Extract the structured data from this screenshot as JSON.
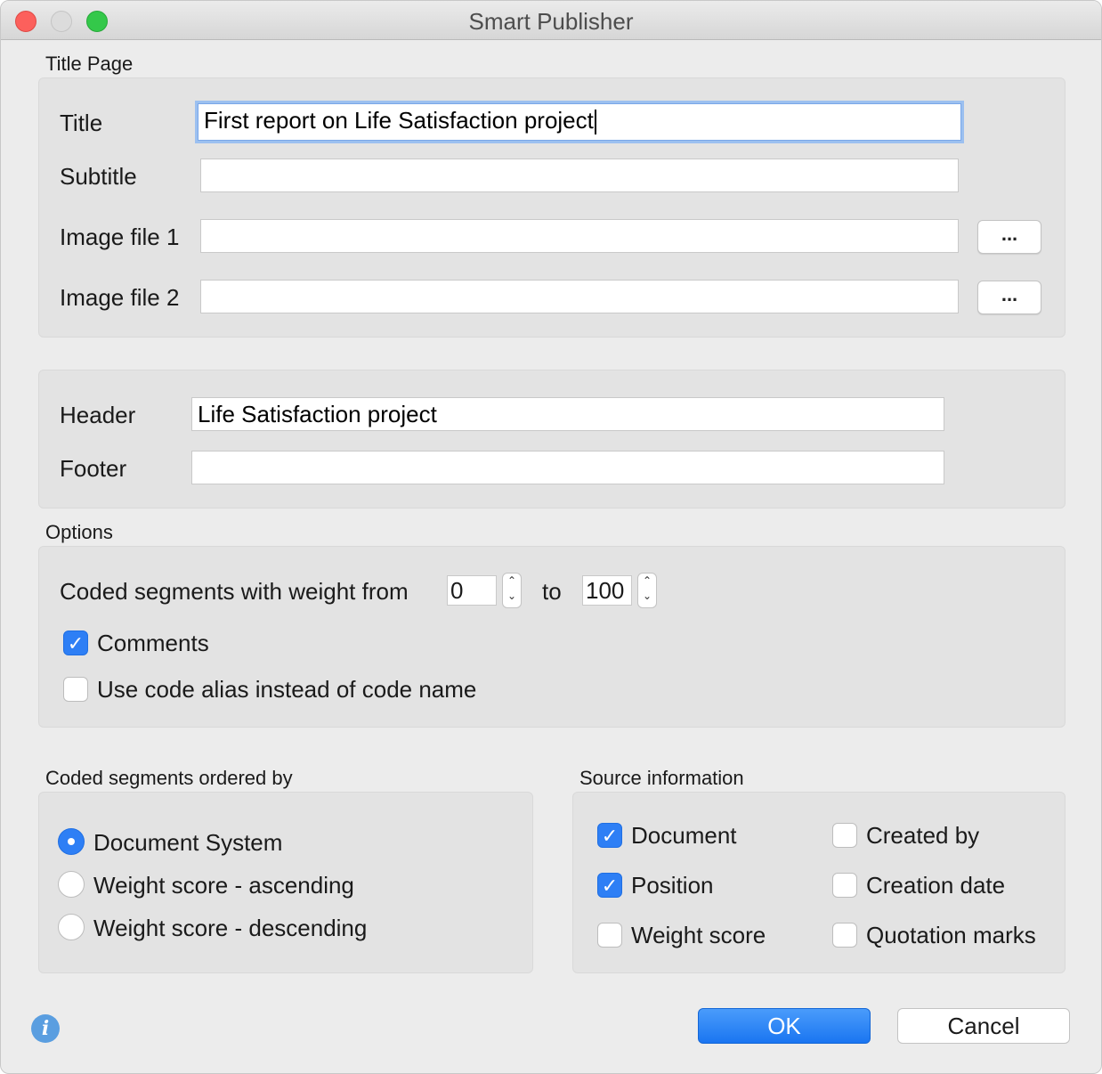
{
  "window": {
    "title": "Smart Publisher"
  },
  "title_page": {
    "section_label": "Title Page",
    "title_label": "Title",
    "title_value": "First report on Life Satisfaction project",
    "subtitle_label": "Subtitle",
    "subtitle_value": "",
    "image1_label": "Image file 1",
    "image1_value": "",
    "image2_label": "Image file 2",
    "image2_value": "",
    "browse_label": "..."
  },
  "header_footer": {
    "header_label": "Header",
    "header_value": "Life Satisfaction project",
    "footer_label": "Footer",
    "footer_value": ""
  },
  "options": {
    "section_label": "Options",
    "weight_label": "Coded segments with weight from",
    "weight_from": "0",
    "to_label": "to",
    "weight_to": "100",
    "comments_label": "Comments",
    "comments_checked": true,
    "alias_label": "Use code alias instead of code name",
    "alias_checked": false
  },
  "ordering": {
    "section_label": "Coded segments ordered by",
    "items": [
      {
        "label": "Document System",
        "selected": true
      },
      {
        "label": "Weight score - ascending",
        "selected": false
      },
      {
        "label": "Weight score - descending",
        "selected": false
      }
    ]
  },
  "source_info": {
    "section_label": "Source information",
    "items": [
      {
        "label": "Document",
        "checked": true
      },
      {
        "label": "Created by",
        "checked": false
      },
      {
        "label": "Position",
        "checked": true
      },
      {
        "label": "Creation date",
        "checked": false
      },
      {
        "label": "Weight score",
        "checked": false
      },
      {
        "label": "Quotation marks",
        "checked": false
      }
    ]
  },
  "footer_buttons": {
    "info_icon": "i",
    "ok_label": "OK",
    "cancel_label": "Cancel"
  },
  "colors": {
    "accent": "#2e7ff5",
    "close": "#fc605c",
    "maximize": "#34c84a"
  }
}
